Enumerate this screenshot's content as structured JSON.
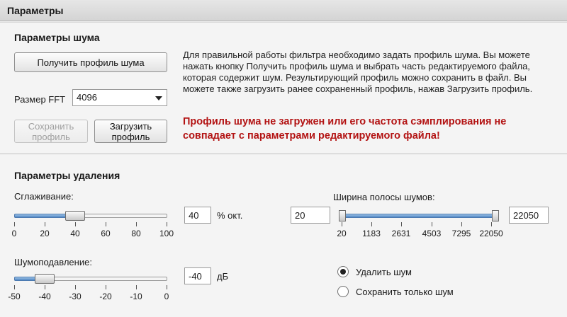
{
  "header": {
    "title": "Параметры"
  },
  "noise": {
    "title": "Параметры шума",
    "get_profile_label": "Получить профиль шума",
    "fft_label": "Размер FFT",
    "fft_value": "4096",
    "save_label": "Сохранить профиль",
    "load_label": "Загрузить профиль",
    "description": "Для правильной работы фильтра необходимо задать профиль шума. Вы можете нажать кнопку Получить профиль шума и выбрать часть редактируемого файла, которая содержит шум. Результирующий профиль можно сохранить в файл. Вы можете также загрузить ранее сохраненный профиль, нажав Загрузить профиль.",
    "warning": "Профиль шума не загружен или его частота сэмплирования не совпадает с параметрами редактируемого файла!"
  },
  "removal": {
    "title": "Параметры удаления",
    "smoothing": {
      "label": "Сглаживание:",
      "value": "40",
      "unit": "% окт.",
      "level": 40,
      "ticks": [
        "0",
        "20",
        "40",
        "60",
        "80",
        "100"
      ]
    },
    "suppression": {
      "label": "Шумоподавление:",
      "value": "-40",
      "unit": "дБ",
      "level": -40,
      "ticks": [
        "-50",
        "-40",
        "-30",
        "-20",
        "-10",
        "0"
      ]
    },
    "bandwidth": {
      "label": "Ширина полосы шумов:",
      "low": "20",
      "high": "22050",
      "ticks": [
        "20",
        "1183",
        "2631",
        "4503",
        "7295",
        "22050"
      ]
    },
    "mode": {
      "remove_label": "Удалить шум",
      "keep_label": "Сохранить только шум",
      "selected": "remove"
    }
  },
  "colors": {
    "warning": "#b31313",
    "accent": "#4f86c4"
  }
}
